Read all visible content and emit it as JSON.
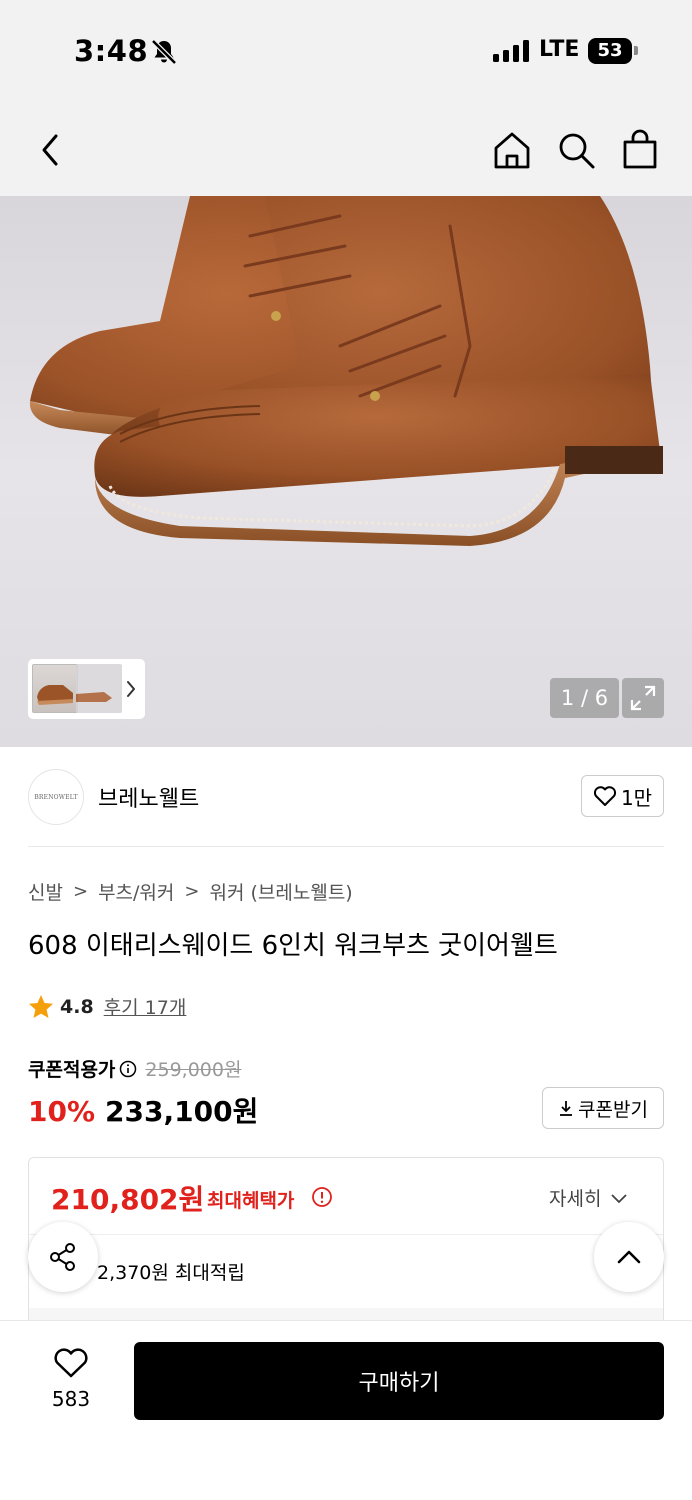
{
  "status_bar": {
    "time": "3:48",
    "network": "LTE",
    "battery": "53",
    "icons": [
      "bell-slash-icon",
      "signal-bars-icon",
      "battery-icon"
    ]
  },
  "nav": {
    "icons": [
      "back-chevron-icon",
      "home-icon",
      "search-icon",
      "shopping-bag-icon"
    ]
  },
  "gallery": {
    "page_counter": "1 / 6",
    "current_index": 1,
    "total_images": 6,
    "icons": [
      "chevron-right-icon",
      "expand-icon"
    ]
  },
  "brand": {
    "logo_text": "BRENOWELT",
    "name": "브레노웰트",
    "like_count": "1만"
  },
  "breadcrumb": [
    "신발",
    "부츠/워커",
    "워커 (브레노웰트)"
  ],
  "product": {
    "title": "608 이태리스웨이드 6인치 워크부츠 굿이어웰트",
    "rating": "4.8",
    "review_link": "후기 17개"
  },
  "pricing": {
    "coupon_price_label": "쿠폰적용가",
    "original_price": "259,000원",
    "discount": "10%",
    "sale_price": "233,100원",
    "coupon_button": "쿠폰받기"
  },
  "benefit": {
    "max_price": "210,802원",
    "max_label": "최대혜택가",
    "detail_label": "자세히",
    "points": "2,370원 최대적립"
  },
  "bottom": {
    "wish_count": "583",
    "buy_button": "구매하기"
  },
  "colors": {
    "accent_red": "#e0211c",
    "buy_button": "#000000",
    "rating_star": "#f5a00a"
  }
}
